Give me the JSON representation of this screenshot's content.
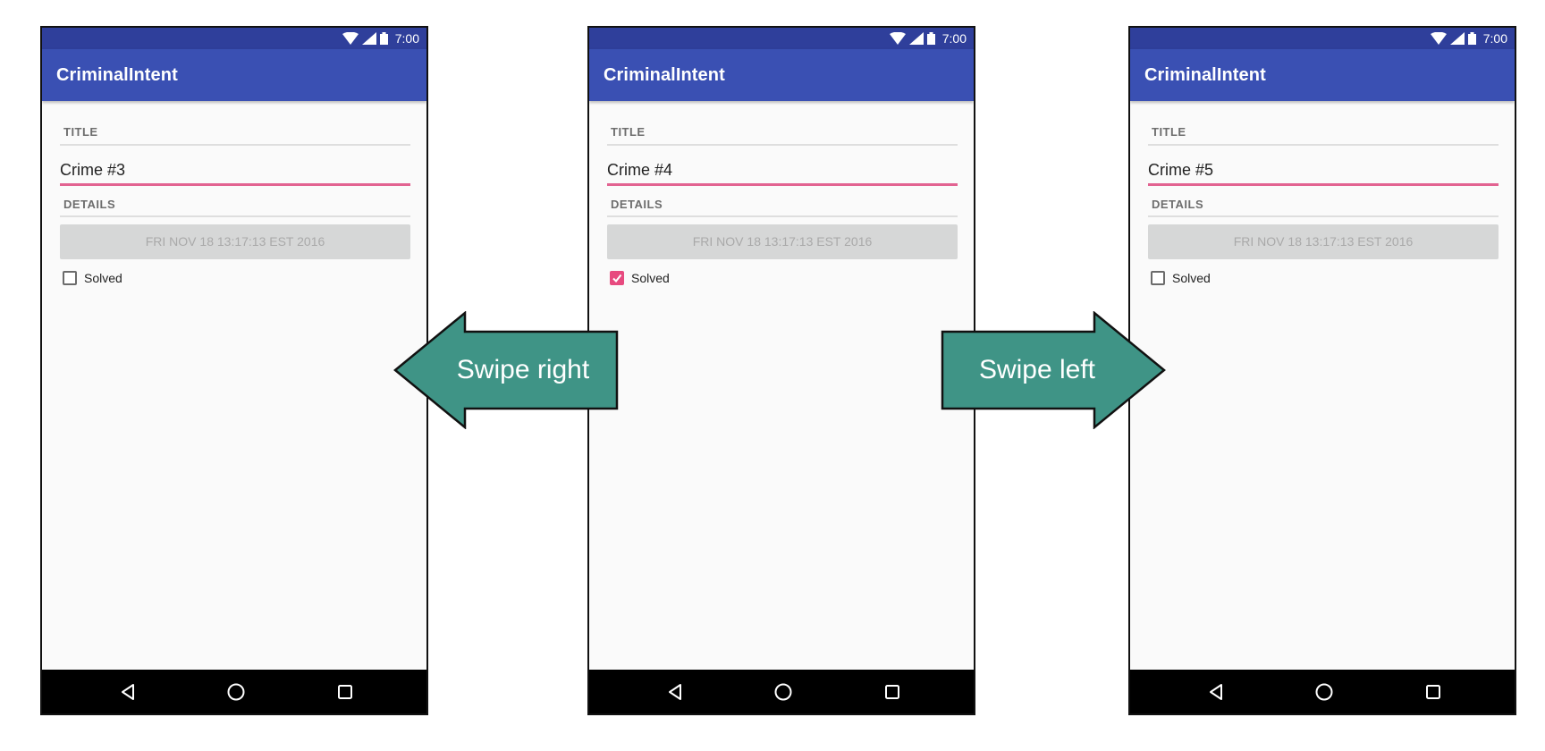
{
  "phones": [
    {
      "status_time": "7:00",
      "app_title": "CriminalIntent",
      "title_label": "TITLE",
      "title_value": "Crime #3",
      "details_label": "DETAILS",
      "date": "FRI NOV 18 13:17:13 EST 2016",
      "solved_label": "Solved",
      "solved": false
    },
    {
      "status_time": "7:00",
      "app_title": "CriminalIntent",
      "title_label": "TITLE",
      "title_value": "Crime #4",
      "details_label": "DETAILS",
      "date": "FRI NOV 18 13:17:13 EST 2016",
      "solved_label": "Solved",
      "solved": true
    },
    {
      "status_time": "7:00",
      "app_title": "CriminalIntent",
      "title_label": "TITLE",
      "title_value": "Crime #5",
      "details_label": "DETAILS",
      "date": "FRI NOV 18 13:17:13 EST 2016",
      "solved_label": "Solved",
      "solved": false
    }
  ],
  "arrows": {
    "swipe_right": "Swipe right",
    "swipe_left": "Swipe left"
  },
  "colors": {
    "status_bar": "#2f3f9b",
    "app_bar": "#3a50b3",
    "accent": "#e74a7f",
    "arrow_fill": "#3f9486",
    "nav_bar": "#000000"
  },
  "icons": {
    "status": [
      "wifi-icon",
      "signal-icon",
      "battery-icon"
    ],
    "nav": [
      "back-icon",
      "home-icon",
      "recents-icon"
    ]
  }
}
